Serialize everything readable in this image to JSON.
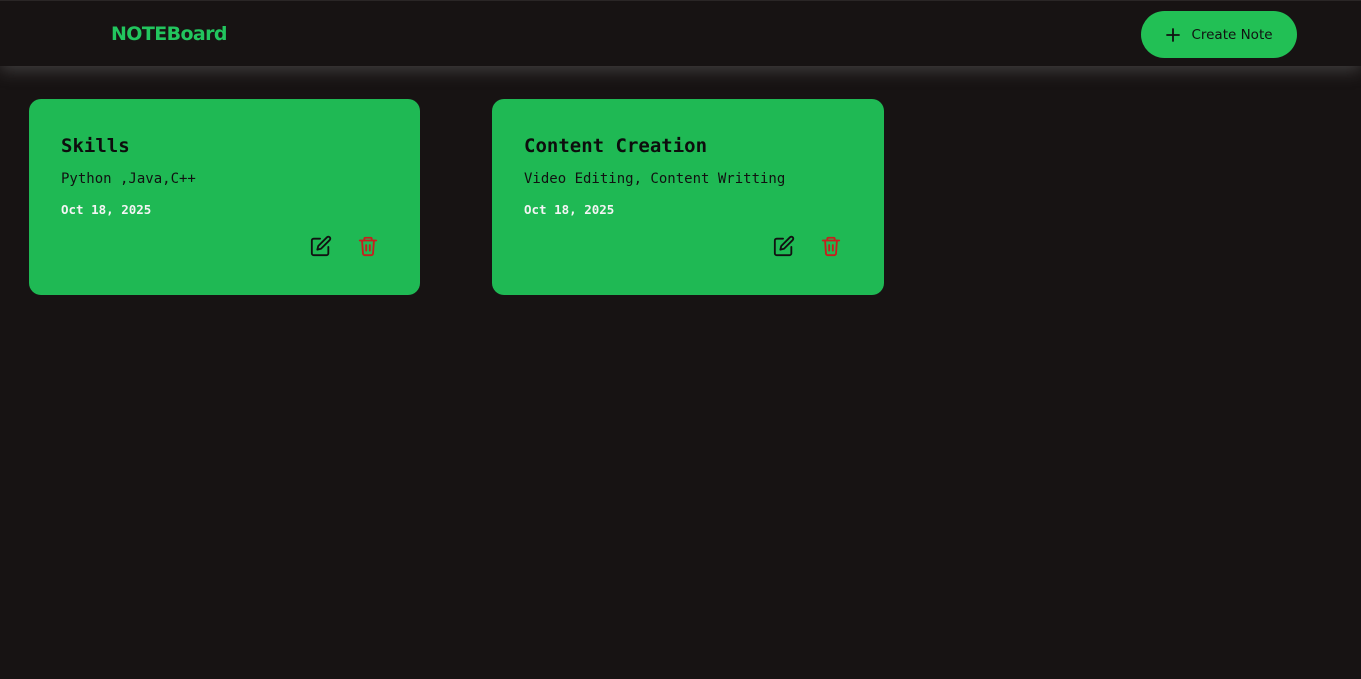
{
  "header": {
    "brand": "NOTEBoard",
    "create_label": "Create Note",
    "create_icon": "plus-icon"
  },
  "notes": [
    {
      "title": "Skills",
      "content": "Python ,Java,C++",
      "date": "Oct 18, 2025",
      "edit_icon": "edit-icon",
      "delete_icon": "trash-icon"
    },
    {
      "title": "Content Creation",
      "content": "Video Editing, Content Writting",
      "date": "Oct 18, 2025",
      "edit_icon": "edit-icon",
      "delete_icon": "trash-icon"
    }
  ],
  "colors": {
    "background": "#171313",
    "accent": "#22c55e",
    "card": "#1fb954",
    "delete": "#c81e1e"
  }
}
